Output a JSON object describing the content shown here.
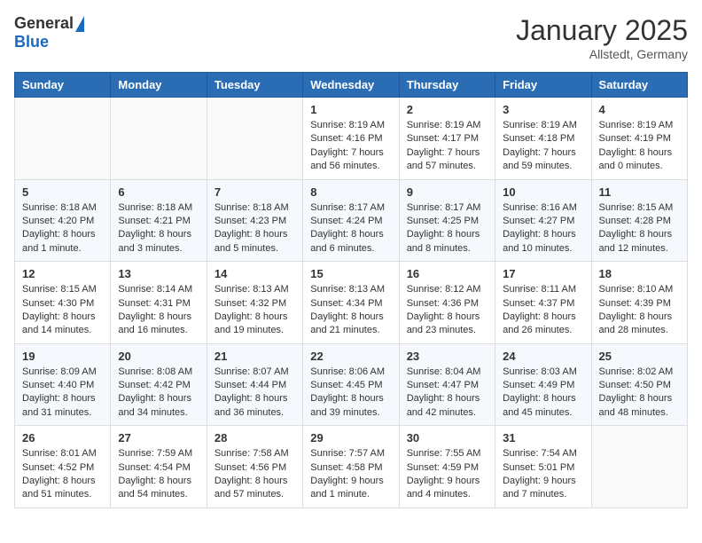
{
  "header": {
    "logo_general": "General",
    "logo_blue": "Blue",
    "month": "January 2025",
    "location": "Allstedt, Germany"
  },
  "weekdays": [
    "Sunday",
    "Monday",
    "Tuesday",
    "Wednesday",
    "Thursday",
    "Friday",
    "Saturday"
  ],
  "weeks": [
    [
      {
        "day": "",
        "detail": ""
      },
      {
        "day": "",
        "detail": ""
      },
      {
        "day": "",
        "detail": ""
      },
      {
        "day": "1",
        "detail": "Sunrise: 8:19 AM\nSunset: 4:16 PM\nDaylight: 7 hours and 56 minutes."
      },
      {
        "day": "2",
        "detail": "Sunrise: 8:19 AM\nSunset: 4:17 PM\nDaylight: 7 hours and 57 minutes."
      },
      {
        "day": "3",
        "detail": "Sunrise: 8:19 AM\nSunset: 4:18 PM\nDaylight: 7 hours and 59 minutes."
      },
      {
        "day": "4",
        "detail": "Sunrise: 8:19 AM\nSunset: 4:19 PM\nDaylight: 8 hours and 0 minutes."
      }
    ],
    [
      {
        "day": "5",
        "detail": "Sunrise: 8:18 AM\nSunset: 4:20 PM\nDaylight: 8 hours and 1 minute."
      },
      {
        "day": "6",
        "detail": "Sunrise: 8:18 AM\nSunset: 4:21 PM\nDaylight: 8 hours and 3 minutes."
      },
      {
        "day": "7",
        "detail": "Sunrise: 8:18 AM\nSunset: 4:23 PM\nDaylight: 8 hours and 5 minutes."
      },
      {
        "day": "8",
        "detail": "Sunrise: 8:17 AM\nSunset: 4:24 PM\nDaylight: 8 hours and 6 minutes."
      },
      {
        "day": "9",
        "detail": "Sunrise: 8:17 AM\nSunset: 4:25 PM\nDaylight: 8 hours and 8 minutes."
      },
      {
        "day": "10",
        "detail": "Sunrise: 8:16 AM\nSunset: 4:27 PM\nDaylight: 8 hours and 10 minutes."
      },
      {
        "day": "11",
        "detail": "Sunrise: 8:15 AM\nSunset: 4:28 PM\nDaylight: 8 hours and 12 minutes."
      }
    ],
    [
      {
        "day": "12",
        "detail": "Sunrise: 8:15 AM\nSunset: 4:30 PM\nDaylight: 8 hours and 14 minutes."
      },
      {
        "day": "13",
        "detail": "Sunrise: 8:14 AM\nSunset: 4:31 PM\nDaylight: 8 hours and 16 minutes."
      },
      {
        "day": "14",
        "detail": "Sunrise: 8:13 AM\nSunset: 4:32 PM\nDaylight: 8 hours and 19 minutes."
      },
      {
        "day": "15",
        "detail": "Sunrise: 8:13 AM\nSunset: 4:34 PM\nDaylight: 8 hours and 21 minutes."
      },
      {
        "day": "16",
        "detail": "Sunrise: 8:12 AM\nSunset: 4:36 PM\nDaylight: 8 hours and 23 minutes."
      },
      {
        "day": "17",
        "detail": "Sunrise: 8:11 AM\nSunset: 4:37 PM\nDaylight: 8 hours and 26 minutes."
      },
      {
        "day": "18",
        "detail": "Sunrise: 8:10 AM\nSunset: 4:39 PM\nDaylight: 8 hours and 28 minutes."
      }
    ],
    [
      {
        "day": "19",
        "detail": "Sunrise: 8:09 AM\nSunset: 4:40 PM\nDaylight: 8 hours and 31 minutes."
      },
      {
        "day": "20",
        "detail": "Sunrise: 8:08 AM\nSunset: 4:42 PM\nDaylight: 8 hours and 34 minutes."
      },
      {
        "day": "21",
        "detail": "Sunrise: 8:07 AM\nSunset: 4:44 PM\nDaylight: 8 hours and 36 minutes."
      },
      {
        "day": "22",
        "detail": "Sunrise: 8:06 AM\nSunset: 4:45 PM\nDaylight: 8 hours and 39 minutes."
      },
      {
        "day": "23",
        "detail": "Sunrise: 8:04 AM\nSunset: 4:47 PM\nDaylight: 8 hours and 42 minutes."
      },
      {
        "day": "24",
        "detail": "Sunrise: 8:03 AM\nSunset: 4:49 PM\nDaylight: 8 hours and 45 minutes."
      },
      {
        "day": "25",
        "detail": "Sunrise: 8:02 AM\nSunset: 4:50 PM\nDaylight: 8 hours and 48 minutes."
      }
    ],
    [
      {
        "day": "26",
        "detail": "Sunrise: 8:01 AM\nSunset: 4:52 PM\nDaylight: 8 hours and 51 minutes."
      },
      {
        "day": "27",
        "detail": "Sunrise: 7:59 AM\nSunset: 4:54 PM\nDaylight: 8 hours and 54 minutes."
      },
      {
        "day": "28",
        "detail": "Sunrise: 7:58 AM\nSunset: 4:56 PM\nDaylight: 8 hours and 57 minutes."
      },
      {
        "day": "29",
        "detail": "Sunrise: 7:57 AM\nSunset: 4:58 PM\nDaylight: 9 hours and 1 minute."
      },
      {
        "day": "30",
        "detail": "Sunrise: 7:55 AM\nSunset: 4:59 PM\nDaylight: 9 hours and 4 minutes."
      },
      {
        "day": "31",
        "detail": "Sunrise: 7:54 AM\nSunset: 5:01 PM\nDaylight: 9 hours and 7 minutes."
      },
      {
        "day": "",
        "detail": ""
      }
    ]
  ]
}
